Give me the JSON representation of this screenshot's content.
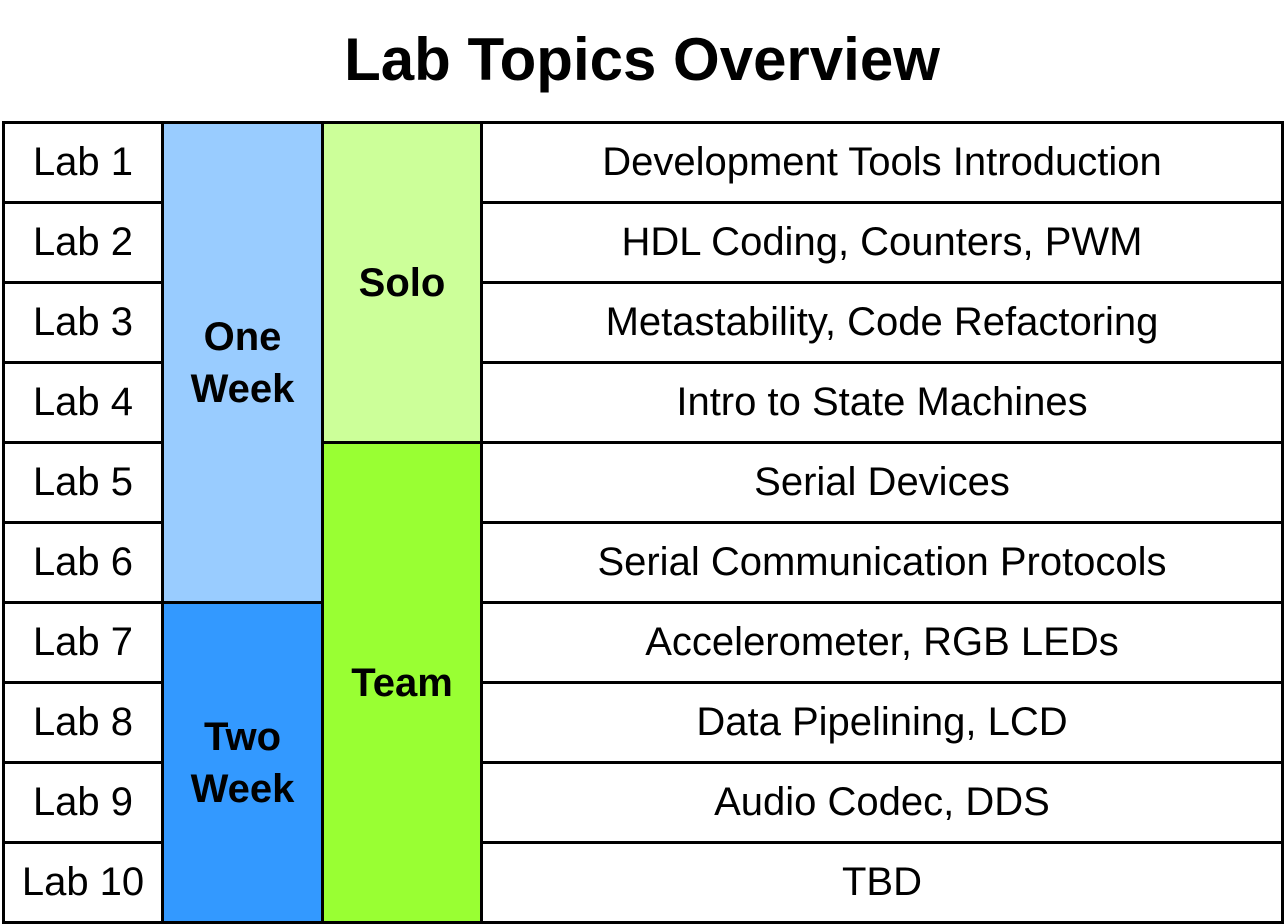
{
  "title": "Lab Topics Overview",
  "colors": {
    "one_week": "#99ccff",
    "two_week": "#3399ff",
    "solo": "#ccff99",
    "team": "#99ff33",
    "border": "#000000"
  },
  "labs": [
    {
      "label": "Lab 1",
      "topic": "Development Tools Introduction"
    },
    {
      "label": "Lab 2",
      "topic": "HDL Coding, Counters, PWM"
    },
    {
      "label": "Lab 3",
      "topic": "Metastability, Code Refactoring"
    },
    {
      "label": "Lab 4",
      "topic": "Intro to State Machines"
    },
    {
      "label": "Lab 5",
      "topic": "Serial Devices"
    },
    {
      "label": "Lab 6",
      "topic": "Serial Communication Protocols"
    },
    {
      "label": "Lab 7",
      "topic": "Accelerometer, RGB LEDs"
    },
    {
      "label": "Lab 8",
      "topic": "Data Pipelining, LCD"
    },
    {
      "label": "Lab 9",
      "topic": "Audio Codec, DDS"
    },
    {
      "label": "Lab 10",
      "topic": "TBD"
    }
  ],
  "duration": {
    "one_week": {
      "line1": "One",
      "line2": "Week"
    },
    "two_week": {
      "line1": "Two",
      "line2": "Week"
    }
  },
  "mode": {
    "solo": "Solo",
    "team": "Team"
  }
}
